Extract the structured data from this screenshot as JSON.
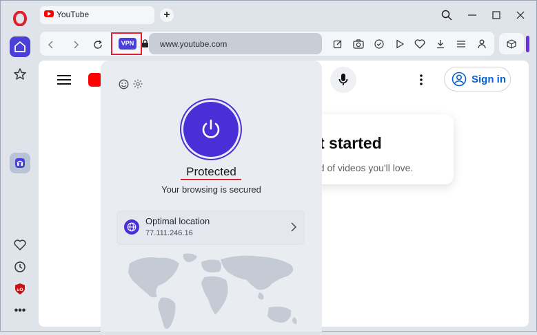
{
  "browser": {
    "tab": {
      "title": "YouTube"
    },
    "address": {
      "url": "www.youtube.com",
      "vpn_badge": "VPN"
    }
  },
  "panel": {
    "status": "Protected",
    "status_sub": "Your browsing is secured",
    "location": {
      "name": "Optimal location",
      "ip": "77.111.246.16"
    }
  },
  "page": {
    "heading": "t started",
    "subtext": "ed of videos you'll love.",
    "signin": "Sign in"
  },
  "colors": {
    "accent": "#4a2fd6",
    "highlight": "#e02030",
    "youtube_red": "#ff0000"
  },
  "icons": [
    "opera-logo-icon",
    "home-icon",
    "star-icon",
    "vpn-sidebar-icon",
    "heart-icon",
    "history-icon",
    "ublock-icon",
    "more-icon",
    "search-icon",
    "minimize-icon",
    "maximize-icon",
    "close-icon",
    "back-icon",
    "forward-icon",
    "reload-icon",
    "lock-icon",
    "edit-icon",
    "camera-icon",
    "shield-check-icon",
    "play-icon",
    "heart-icon",
    "download-icon",
    "menu-icon",
    "person-icon",
    "cube-icon",
    "power-icon",
    "globe-icon",
    "chevron-right-icon",
    "emoji-icon",
    "gear-icon",
    "mic-icon",
    "hamburger-icon"
  ]
}
